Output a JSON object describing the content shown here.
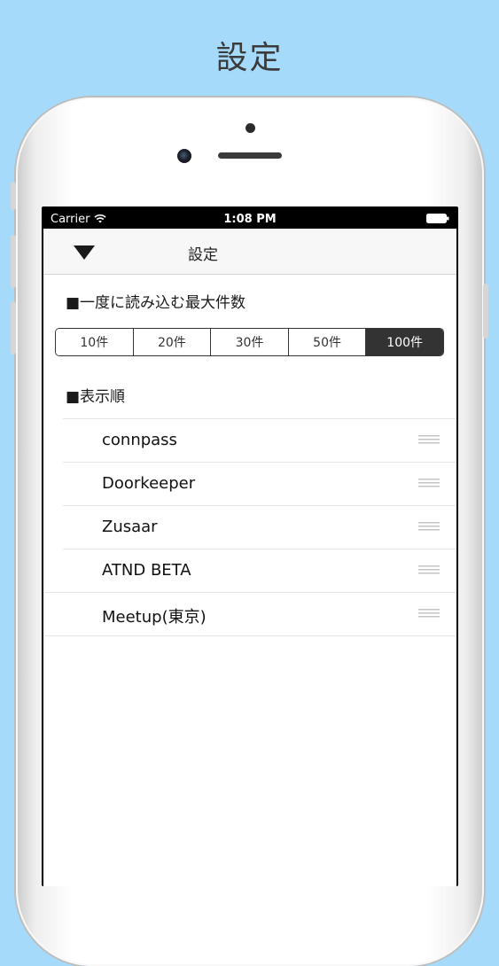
{
  "promo": {
    "title": "設定"
  },
  "status_bar": {
    "carrier": "Carrier",
    "time": "1:08 PM",
    "wifi_icon": "wifi-icon",
    "battery_icon": "battery-icon"
  },
  "nav": {
    "title": "設定",
    "back_icon": "down-triangle-icon"
  },
  "settings": {
    "max_count_label": "■一度に読み込む最大件数",
    "options": [
      "10件",
      "20件",
      "30件",
      "50件",
      "100件"
    ],
    "selected_option": "100件",
    "order_label": "■表示順",
    "order_items": [
      "connpass",
      "Doorkeeper",
      "Zusaar",
      "ATND BETA",
      "Meetup(東京)"
    ],
    "reorder_icon": "reorder-handle-icon"
  },
  "colors": {
    "background": "#a6dafb",
    "selected_segment": "#333333",
    "nav_bar": "#f7f7f7"
  }
}
